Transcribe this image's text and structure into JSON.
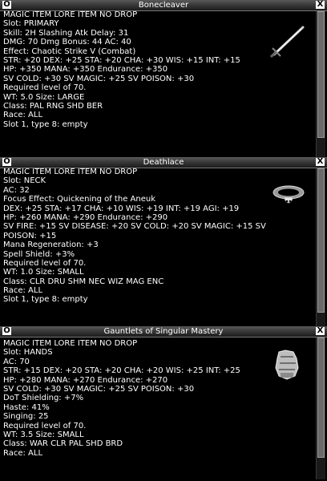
{
  "windows": [
    {
      "title": "Bonecleaver",
      "icon": "sword-icon",
      "lines": [
        "MAGIC ITEM LORE ITEM NO DROP",
        "Slot: PRIMARY",
        "Skill: 2H Slashing Atk Delay: 31",
        "DMG: 70 Dmg Bonus: 44 AC: 40",
        "Effect: Chaotic Strike V (Combat)",
        "STR: +20 DEX: +25 STA: +20 CHA: +30 WIS: +15 INT: +15",
        "HP: +350 MANA: +350 Endurance: +350",
        "SV COLD: +30 SV MAGIC: +25 SV POISON: +30",
        "Required level of 70.",
        "WT: 5.0 Size: LARGE",
        "Class: PAL RNG SHD BER",
        "Race: ALL",
        "Slot 1, type 8: empty"
      ]
    },
    {
      "title": "Deathlace",
      "icon": "necklace-icon",
      "lines": [
        "MAGIC ITEM LORE ITEM NO DROP",
        "Slot: NECK",
        "AC: 32",
        "Focus Effect: Quickening of the Aneuk",
        "DEX: +25 STA: +17 CHA: +10 WIS: +19 INT: +19 AGI: +19",
        "HP: +260 MANA: +290 Endurance: +290",
        "SV FIRE: +15 SV DISEASE: +20 SV COLD: +20 SV MAGIC: +15 SV",
        "POISON: +15",
        "Mana Regeneration: +3",
        "Spell Shield: +3%",
        "Required level of 70.",
        "WT: 1.0 Size: SMALL",
        "Class: CLR DRU SHM NEC WIZ MAG ENC",
        "Race: ALL",
        "Slot 1, type 8: empty"
      ]
    },
    {
      "title": "Gauntlets of Singular Mastery",
      "icon": "gauntlet-icon",
      "lines": [
        "MAGIC ITEM LORE ITEM NO DROP",
        "Slot: HANDS",
        "AC: 70",
        "STR: +15 DEX: +20 STA: +20 CHA: +20 WIS: +25 INT: +25",
        "HP: +280 MANA: +270 Endurance: +270",
        "SV COLD: +30 SV MAGIC: +25 SV POISON: +30",
        "DoT Shielding: +7%",
        "Haste: 41%",
        "Singing: 25",
        "Required level of 70.",
        "WT: 3.5 Size: SMALL",
        "Class: WAR CLR PAL SHD BRD",
        "Race: ALL"
      ]
    }
  ],
  "buttons": {
    "minimize": "O",
    "close": "X"
  }
}
